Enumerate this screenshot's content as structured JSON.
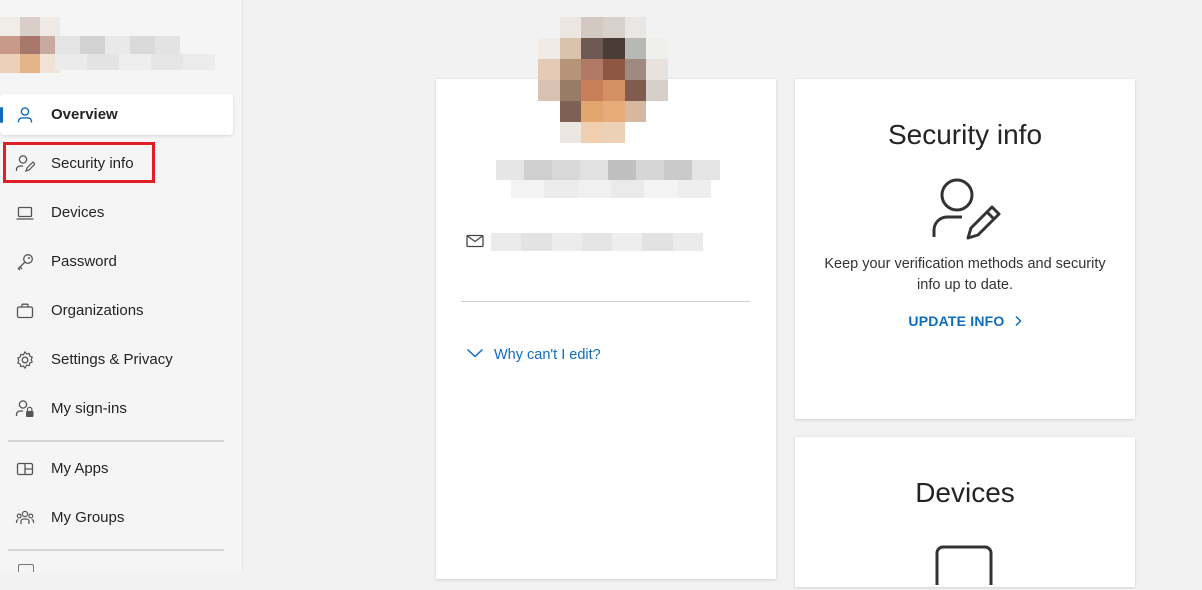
{
  "sidebar": {
    "items": [
      {
        "label": "Overview",
        "icon": "person-icon"
      },
      {
        "label": "Security info",
        "icon": "person-key-icon"
      },
      {
        "label": "Devices",
        "icon": "laptop-icon"
      },
      {
        "label": "Password",
        "icon": "key-icon"
      },
      {
        "label": "Organizations",
        "icon": "briefcase-icon"
      },
      {
        "label": "Settings & Privacy",
        "icon": "gear-icon"
      },
      {
        "label": "My sign-ins",
        "icon": "person-lock-icon"
      },
      {
        "label": "My Apps",
        "icon": "apps-icon"
      },
      {
        "label": "My Groups",
        "icon": "people-icon"
      }
    ],
    "active_index": 0
  },
  "profile": {
    "why_cant_edit": "Why can't I edit?"
  },
  "security_card": {
    "title": "Security info",
    "description": "Keep your verification methods and security info up to date.",
    "link_label": "UPDATE INFO"
  },
  "devices_card": {
    "title": "Devices"
  },
  "colors": {
    "accent": "#0f6cbd",
    "highlight": "#e01e26"
  }
}
